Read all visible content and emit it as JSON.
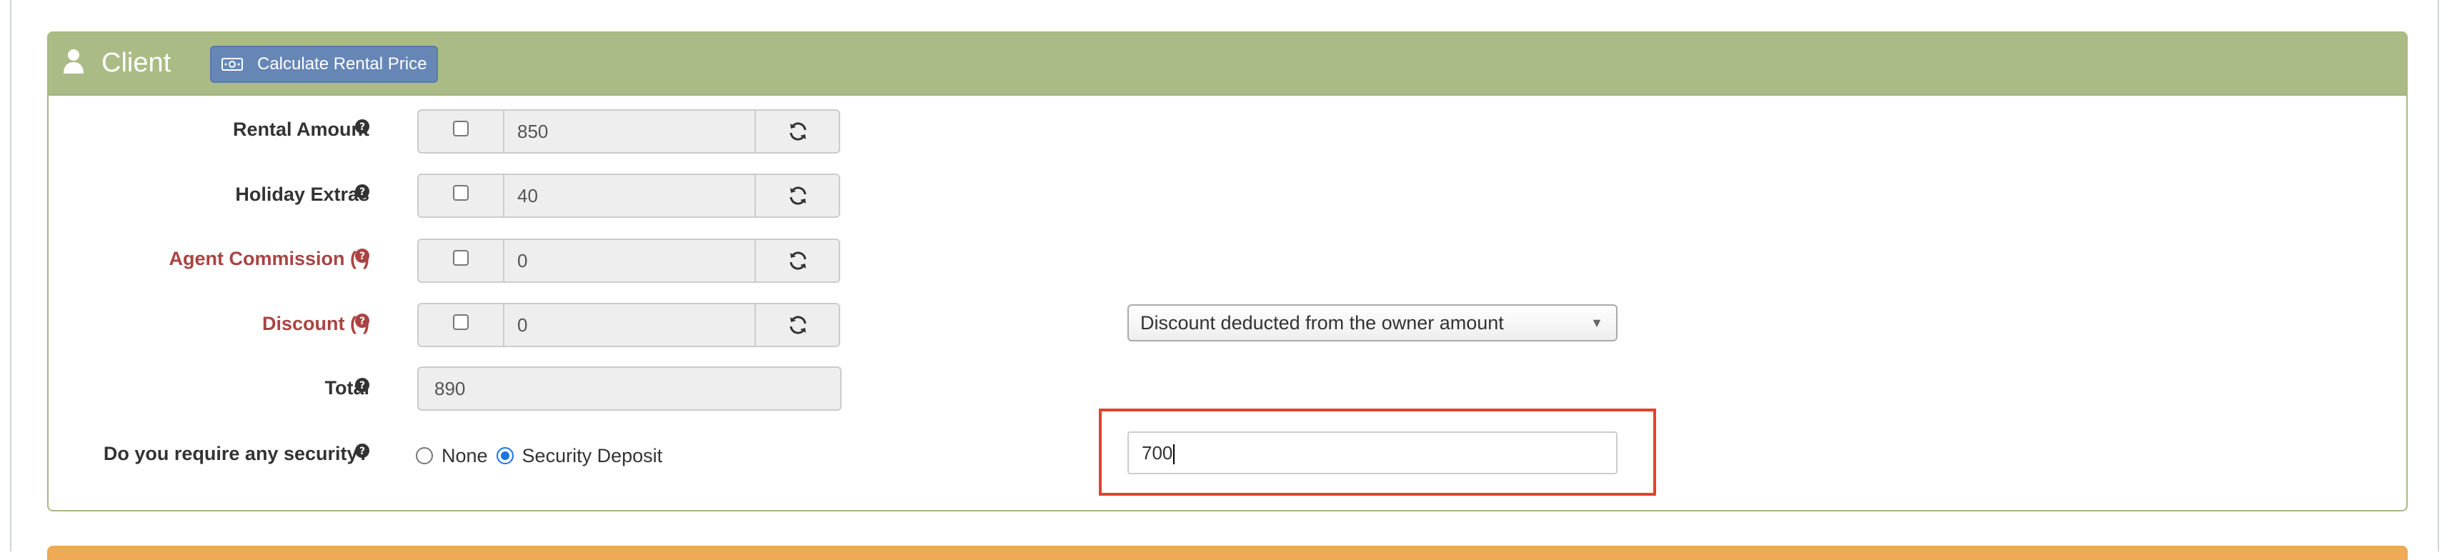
{
  "panel": {
    "title": "Client",
    "calculate_button_label": "Calculate Rental Price"
  },
  "rows": [
    {
      "label": "Rental Amount",
      "value": "850",
      "checked": false,
      "color": "#333333"
    },
    {
      "label": "Holiday Extras",
      "value": "40",
      "checked": false,
      "color": "#333333"
    },
    {
      "label": "Agent Commission (-)",
      "value": "0",
      "checked": false,
      "color": "#a94442"
    },
    {
      "label": "Discount (-)",
      "value": "0",
      "checked": false,
      "color": "#a94442"
    }
  ],
  "total": {
    "label": "Total",
    "value": "890"
  },
  "discount_option": {
    "selected": "Discount deducted from the owner amount"
  },
  "security": {
    "label": "Do you require any security?",
    "options": [
      {
        "label": "None",
        "checked": false
      },
      {
        "label": "Security Deposit",
        "checked": true
      }
    ],
    "deposit_value": "700"
  },
  "colors": {
    "panel_header": "#abbb85",
    "panel_border": "#a9b97e",
    "button": "#6687b6",
    "warning_label": "#a94442",
    "highlight": "#e0442c",
    "next_panel": "#eeaa55"
  },
  "icons": {
    "header": "user-icon",
    "button": "money-icon",
    "help": "question-circle-icon",
    "refresh": "refresh-icon",
    "select": "caret-down-icon"
  }
}
